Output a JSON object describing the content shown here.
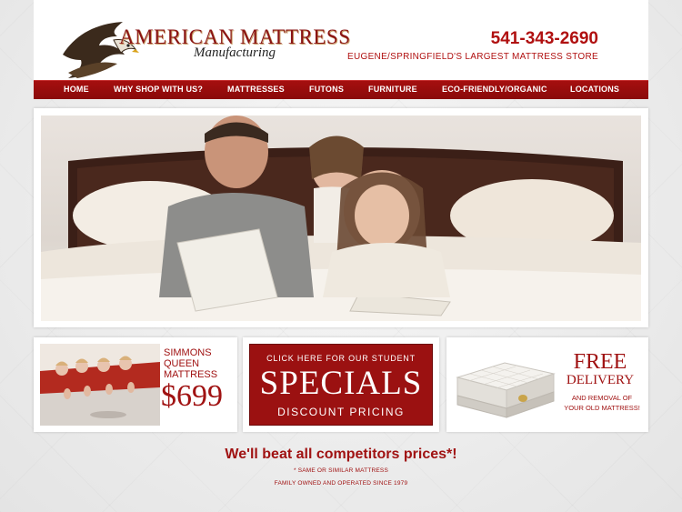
{
  "header": {
    "logo_title": "AMERICAN MATTRESS",
    "logo_subtitle": "Manufacturing",
    "phone": "541-343-2690",
    "tagline": "EUGENE/SPRINGFIELD'S LARGEST MATTRESS STORE"
  },
  "nav": {
    "items": [
      {
        "label": "HOME"
      },
      {
        "label": "WHY SHOP WITH US?"
      },
      {
        "label": "MATTRESSES"
      },
      {
        "label": "FUTONS"
      },
      {
        "label": "FURNITURE"
      },
      {
        "label": "ECO-FRIENDLY/ORGANIC"
      },
      {
        "label": "LOCATIONS"
      }
    ]
  },
  "promos": {
    "simmons": {
      "line1": "SIMMONS",
      "line2": "QUEEN",
      "line3": "MATTRESS",
      "price": "$699"
    },
    "specials": {
      "top": "CLICK HERE FOR OUR STUDENT",
      "main": "SPECIALS",
      "bottom": "DISCOUNT PRICING"
    },
    "delivery": {
      "title1": "FREE",
      "title2": "DELIVERY",
      "sub1": "AND REMOVAL OF",
      "sub2": "YOUR OLD MATTRESS!"
    }
  },
  "footer": {
    "headline": "We'll beat all competitors prices*!",
    "note1": "* SAME OR SIMILAR MATTRESS",
    "note2": "FAMILY OWNED AND OPERATED SINCE 1979"
  },
  "colors": {
    "brand_red": "#a01212",
    "nav_red": "#8a0a0a"
  }
}
